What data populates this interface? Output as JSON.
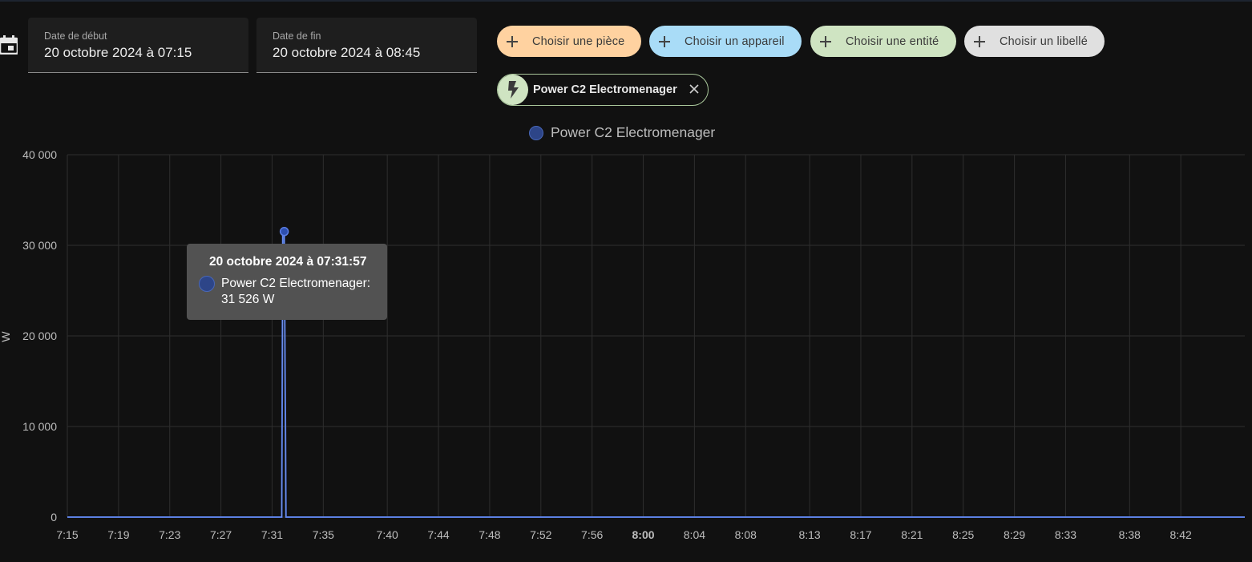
{
  "date_range": {
    "start_label": "Date de début",
    "start_value": "20 octobre 2024 à 07:15",
    "end_label": "Date de fin",
    "end_value": "20 octobre 2024 à 08:45"
  },
  "pickers": {
    "area": {
      "label": "Choisir une pièce",
      "color": "#ffd2a0"
    },
    "device": {
      "label": "Choisir un appareil",
      "color": "#a9dcf7"
    },
    "entity": {
      "label": "Choisir une entité",
      "color": "#cfe4c2"
    },
    "label": {
      "label": "Choisir un libellé",
      "color": "#e0e0e0"
    }
  },
  "selected_entity": {
    "name": "Power C2 Electromenager",
    "icon": "flash-icon"
  },
  "legend": {
    "series_name": "Power C2 Electromenager",
    "color": "#2d4588"
  },
  "tooltip": {
    "title": "20 octobre 2024 à 07:31:57",
    "series_label": "Power C2 Electromenager:",
    "value": "31 526 W"
  },
  "chart_data": {
    "type": "line",
    "ylabel": "W",
    "ylim": [
      0,
      40000
    ],
    "y_ticks": [
      "0",
      "10 000",
      "20 000",
      "30 000",
      "40 000"
    ],
    "y_tick_values": [
      0,
      10000,
      20000,
      30000,
      40000
    ],
    "xlim": [
      "07:15",
      "08:47"
    ],
    "x_ticks": [
      {
        "label": "7:15",
        "t": "07:15"
      },
      {
        "label": "7:19",
        "t": "07:19"
      },
      {
        "label": "7:23",
        "t": "07:23"
      },
      {
        "label": "7:27",
        "t": "07:27"
      },
      {
        "label": "7:31",
        "t": "07:31"
      },
      {
        "label": "7:35",
        "t": "07:35"
      },
      {
        "label": "7:40",
        "t": "07:40"
      },
      {
        "label": "7:44",
        "t": "07:44"
      },
      {
        "label": "7:48",
        "t": "07:48"
      },
      {
        "label": "7:52",
        "t": "07:52"
      },
      {
        "label": "7:56",
        "t": "07:56"
      },
      {
        "label": "8:00",
        "t": "08:00",
        "bold": true
      },
      {
        "label": "8:04",
        "t": "08:04"
      },
      {
        "label": "8:08",
        "t": "08:08"
      },
      {
        "label": "8:13",
        "t": "08:13"
      },
      {
        "label": "8:17",
        "t": "08:17"
      },
      {
        "label": "8:21",
        "t": "08:21"
      },
      {
        "label": "8:25",
        "t": "08:25"
      },
      {
        "label": "8:29",
        "t": "08:29"
      },
      {
        "label": "8:33",
        "t": "08:33"
      },
      {
        "label": "8:38",
        "t": "08:38"
      },
      {
        "label": "8:42",
        "t": "08:42"
      }
    ],
    "series": [
      {
        "name": "Power C2 Electromenager",
        "color": "#4a72d9",
        "points": [
          {
            "t": "07:15:00",
            "y": 0
          },
          {
            "t": "07:31:45",
            "y": 0
          },
          {
            "t": "07:31:50",
            "y": 31526
          },
          {
            "t": "07:31:57",
            "y": 31526
          },
          {
            "t": "07:32:05",
            "y": 0
          },
          {
            "t": "08:47:00",
            "y": 0
          }
        ]
      }
    ],
    "highlight": {
      "t": "07:31:57",
      "y": 31526
    },
    "grid": true
  }
}
